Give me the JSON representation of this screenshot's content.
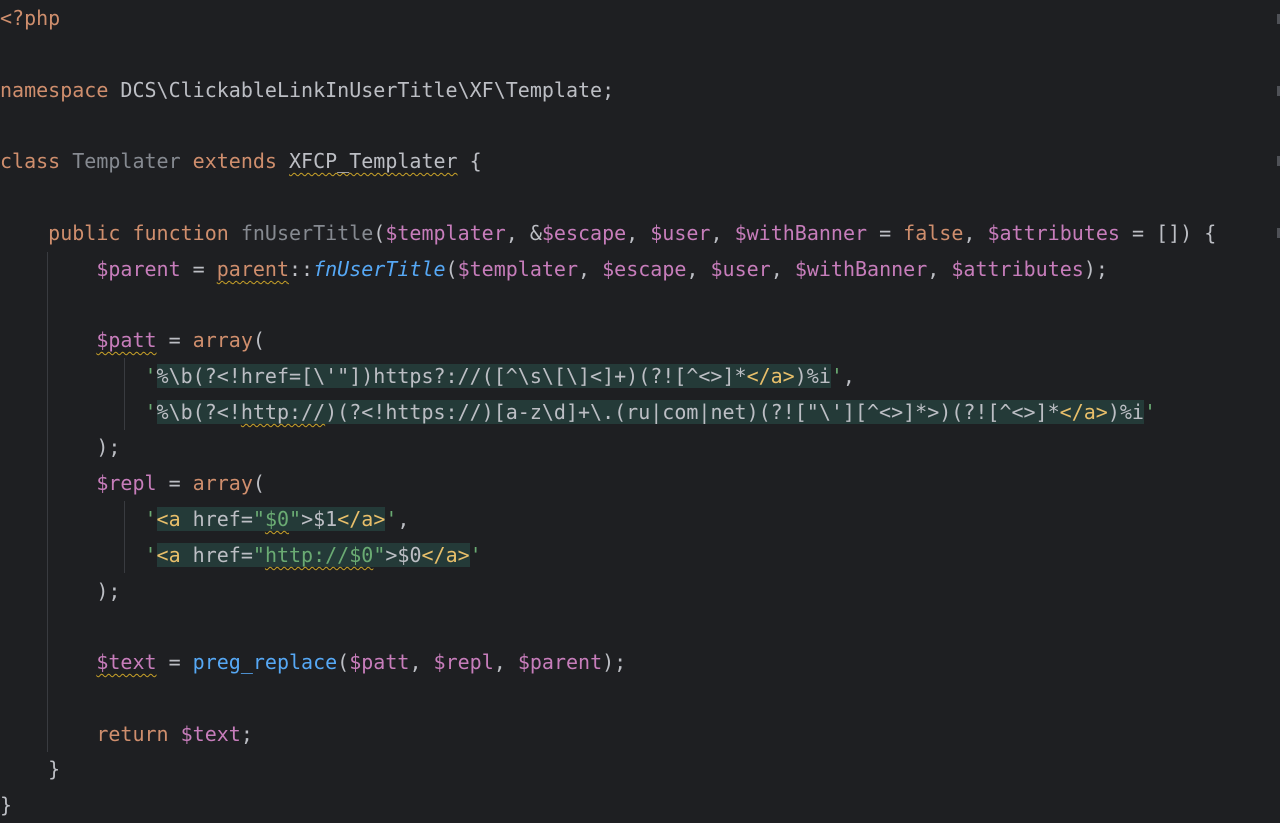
{
  "code_lines": [
    {
      "tokens": [
        {
          "t": "<?php",
          "c": "kw"
        }
      ]
    },
    {
      "tokens": [
        {
          "t": "namespace ",
          "c": "kw"
        },
        {
          "t": "DCS\\ClickableLinkInUserTitle\\XF\\Template;",
          "c": "def"
        }
      ]
    },
    {
      "tokens": [
        {
          "t": "class ",
          "c": "kw"
        },
        {
          "t": "Templater ",
          "c": "dim"
        },
        {
          "t": "extends ",
          "c": "kw"
        },
        {
          "t": "XFCP_Templater",
          "c": "def",
          "u": true
        },
        {
          "t": " {",
          "c": "def"
        }
      ]
    },
    {
      "tokens": [
        {
          "t": "    public function ",
          "c": "kw"
        },
        {
          "t": "fnUserTitle",
          "c": "dim"
        },
        {
          "t": "(",
          "c": "def"
        },
        {
          "t": "$templater",
          "c": "var"
        },
        {
          "t": ", &",
          "c": "def"
        },
        {
          "t": "$escape",
          "c": "var"
        },
        {
          "t": ", ",
          "c": "def"
        },
        {
          "t": "$user",
          "c": "var"
        },
        {
          "t": ", ",
          "c": "def"
        },
        {
          "t": "$withBanner",
          "c": "var"
        },
        {
          "t": " = ",
          "c": "def"
        },
        {
          "t": "false",
          "c": "kw"
        },
        {
          "t": ", ",
          "c": "def"
        },
        {
          "t": "$attributes",
          "c": "var"
        },
        {
          "t": " = []) {",
          "c": "def"
        }
      ]
    },
    {
      "tokens": [
        {
          "t": "        ",
          "c": "def"
        },
        {
          "t": "$parent",
          "c": "var"
        },
        {
          "t": " = ",
          "c": "def"
        },
        {
          "t": "parent",
          "c": "kw",
          "u": true
        },
        {
          "t": "::",
          "c": "def"
        },
        {
          "t": "fnUserTitle",
          "c": "fnst"
        },
        {
          "t": "(",
          "c": "def"
        },
        {
          "t": "$templater",
          "c": "var"
        },
        {
          "t": ", ",
          "c": "def"
        },
        {
          "t": "$escape",
          "c": "var"
        },
        {
          "t": ", ",
          "c": "def"
        },
        {
          "t": "$user",
          "c": "var"
        },
        {
          "t": ", ",
          "c": "def"
        },
        {
          "t": "$withBanner",
          "c": "var"
        },
        {
          "t": ", ",
          "c": "def"
        },
        {
          "t": "$attributes",
          "c": "var"
        },
        {
          "t": ");",
          "c": "def"
        }
      ]
    },
    {
      "tokens": [
        {
          "t": "        ",
          "c": "def"
        },
        {
          "t": "$patt",
          "c": "var",
          "u": true
        },
        {
          "t": " = ",
          "c": "def"
        },
        {
          "t": "array",
          "c": "kw"
        },
        {
          "t": "(",
          "c": "def"
        }
      ]
    },
    {
      "tokens": [
        {
          "t": "            ",
          "c": "def"
        },
        {
          "t": "'",
          "c": "str"
        },
        {
          "t": "%\\b(?<!href=[\\'\"])https?://([^\\s\\[\\]<]+)(?![^<>]*",
          "c": "def",
          "h": true
        },
        {
          "t": "</a>",
          "c": "tag",
          "h": true
        },
        {
          "t": ")%i",
          "c": "def",
          "h": true
        },
        {
          "t": "'",
          "c": "str"
        },
        {
          "t": ",",
          "c": "def"
        }
      ]
    },
    {
      "tokens": [
        {
          "t": "            ",
          "c": "def"
        },
        {
          "t": "'",
          "c": "str"
        },
        {
          "t": "%\\b(?<!",
          "c": "def",
          "h": true
        },
        {
          "t": "http://",
          "c": "def",
          "h": true,
          "u": true
        },
        {
          "t": ")(?<!https://)[a-z\\d]+\\.(ru|com|net)(?![\"\\'][^<>]*>)(?![^<>]*",
          "c": "def",
          "h": true
        },
        {
          "t": "</a>",
          "c": "tag",
          "h": true
        },
        {
          "t": ")%i",
          "c": "def",
          "h": true
        },
        {
          "t": "'",
          "c": "str"
        }
      ]
    },
    {
      "tokens": [
        {
          "t": "        );",
          "c": "def"
        }
      ]
    },
    {
      "tokens": [
        {
          "t": "        ",
          "c": "def"
        },
        {
          "t": "$repl",
          "c": "var"
        },
        {
          "t": " = ",
          "c": "def"
        },
        {
          "t": "array",
          "c": "kw"
        },
        {
          "t": "(",
          "c": "def"
        }
      ]
    },
    {
      "tokens": [
        {
          "t": "            ",
          "c": "def"
        },
        {
          "t": "'",
          "c": "str"
        },
        {
          "t": "<a ",
          "c": "tag",
          "h": true
        },
        {
          "t": "href=",
          "c": "def",
          "h": true
        },
        {
          "t": "\"",
          "c": "str",
          "h": true
        },
        {
          "t": "$0",
          "c": "str",
          "h": true,
          "u": true
        },
        {
          "t": "\"",
          "c": "str",
          "h": true
        },
        {
          "t": ">$1",
          "c": "def",
          "h": true
        },
        {
          "t": "</a>",
          "c": "tag",
          "h": true
        },
        {
          "t": "'",
          "c": "str"
        },
        {
          "t": ",",
          "c": "def"
        }
      ]
    },
    {
      "tokens": [
        {
          "t": "            ",
          "c": "def"
        },
        {
          "t": "'",
          "c": "str"
        },
        {
          "t": "<a ",
          "c": "tag",
          "h": true
        },
        {
          "t": "href=",
          "c": "def",
          "h": true
        },
        {
          "t": "\"",
          "c": "str",
          "h": true
        },
        {
          "t": "http://$0",
          "c": "str",
          "h": true,
          "u": true
        },
        {
          "t": "\"",
          "c": "str",
          "h": true
        },
        {
          "t": ">$0",
          "c": "def",
          "h": true
        },
        {
          "t": "</a>",
          "c": "tag",
          "h": true
        },
        {
          "t": "'",
          "c": "str"
        }
      ]
    },
    {
      "tokens": [
        {
          "t": "        );",
          "c": "def"
        }
      ]
    },
    {
      "tokens": [
        {
          "t": "        ",
          "c": "def"
        },
        {
          "t": "$text",
          "c": "var",
          "u": true
        },
        {
          "t": " = ",
          "c": "def"
        },
        {
          "t": "preg_replace",
          "c": "fn"
        },
        {
          "t": "(",
          "c": "def"
        },
        {
          "t": "$patt",
          "c": "var"
        },
        {
          "t": ", ",
          "c": "def"
        },
        {
          "t": "$repl",
          "c": "var"
        },
        {
          "t": ", ",
          "c": "def"
        },
        {
          "t": "$parent",
          "c": "var"
        },
        {
          "t": ");",
          "c": "def"
        }
      ]
    },
    {
      "tokens": [
        {
          "t": "        return ",
          "c": "kw"
        },
        {
          "t": "$text",
          "c": "var"
        },
        {
          "t": ";",
          "c": "def"
        }
      ]
    },
    {
      "tokens": [
        {
          "t": "    }",
          "c": "def"
        }
      ]
    },
    {
      "tokens": [
        {
          "t": "}",
          "c": "def"
        }
      ]
    }
  ],
  "colors": {
    "background": "#1e1f22",
    "keyword": "#cf8e6d",
    "variable": "#c77dbb",
    "function": "#56a8f5",
    "string": "#6aab73",
    "html_tag": "#e8bf6a",
    "default": "#bcbec4",
    "injected_bg": "#243a38",
    "warning_underline": "#c9a228"
  }
}
